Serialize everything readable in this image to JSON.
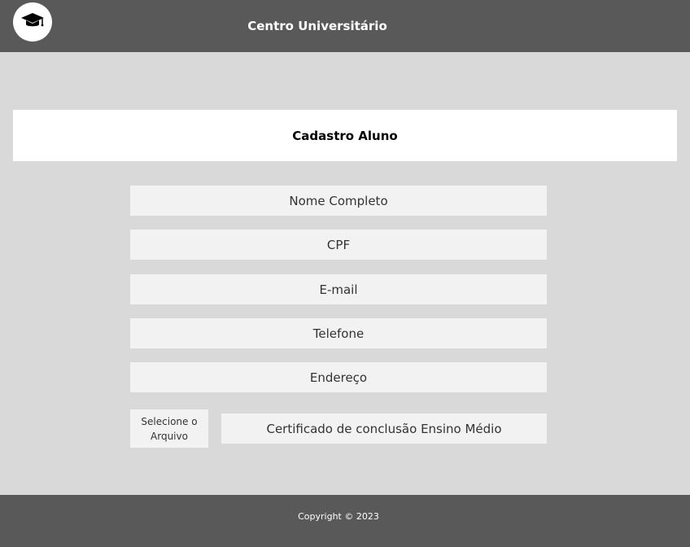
{
  "header": {
    "title": "Centro Universitário",
    "logo_icon": "graduation-cap-icon"
  },
  "form": {
    "title": "Cadastro Aluno",
    "fields": [
      {
        "placeholder": "Nome Completo"
      },
      {
        "placeholder": "CPF"
      },
      {
        "placeholder": "E-mail"
      },
      {
        "placeholder": "Telefone"
      },
      {
        "placeholder": "Endereço"
      }
    ],
    "file_button_label": "Selecione o Arquivo",
    "certificate_placeholder": "Certificado de conclusão Ensino Médio"
  },
  "footer": {
    "copyright": "Copyright © 2023"
  },
  "colors": {
    "header_bg": "#595959",
    "page_bg": "#d9d9d9",
    "field_bg": "#f2f2f2",
    "card_bg": "#ffffff"
  }
}
